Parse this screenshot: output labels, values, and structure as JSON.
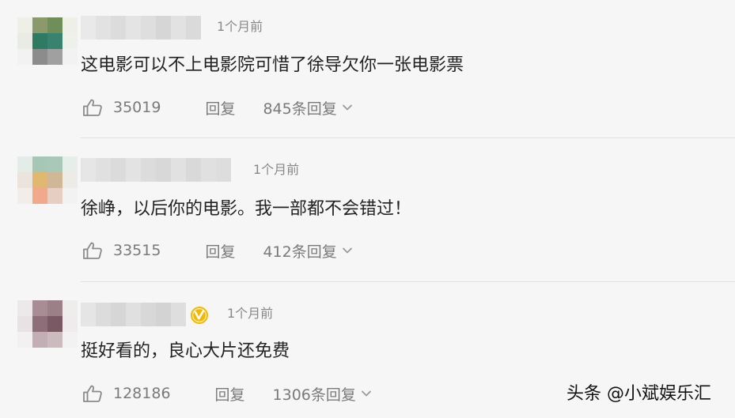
{
  "comments": [
    {
      "time": "1个月前",
      "text": "这电影可以不上电影院可惜了徐导欠你一张电影票",
      "likes": "35019",
      "reply_label": "回复",
      "replies_label": "845条回复",
      "verified": false
    },
    {
      "time": "1个月前",
      "text": "徐峥，以后你的电影。我一部都不会错过！",
      "likes": "33515",
      "reply_label": "回复",
      "replies_label": "412条回复",
      "verified": false
    },
    {
      "time": "1个月前",
      "text": "挺好看的，良心大片还免费",
      "likes": "128186",
      "reply_label": "回复",
      "replies_label": "1306条回复",
      "verified": true
    }
  ],
  "watermark": "头条 @小斌娱乐汇",
  "icons": {
    "like": "thumbs-up-icon",
    "expand": "chevron-down-icon",
    "verified": "verified-v-badge-icon"
  },
  "colors": {
    "background": "#f6f6f6",
    "text": "#222222",
    "muted": "#888888",
    "verified_badge": "#f5b800"
  }
}
